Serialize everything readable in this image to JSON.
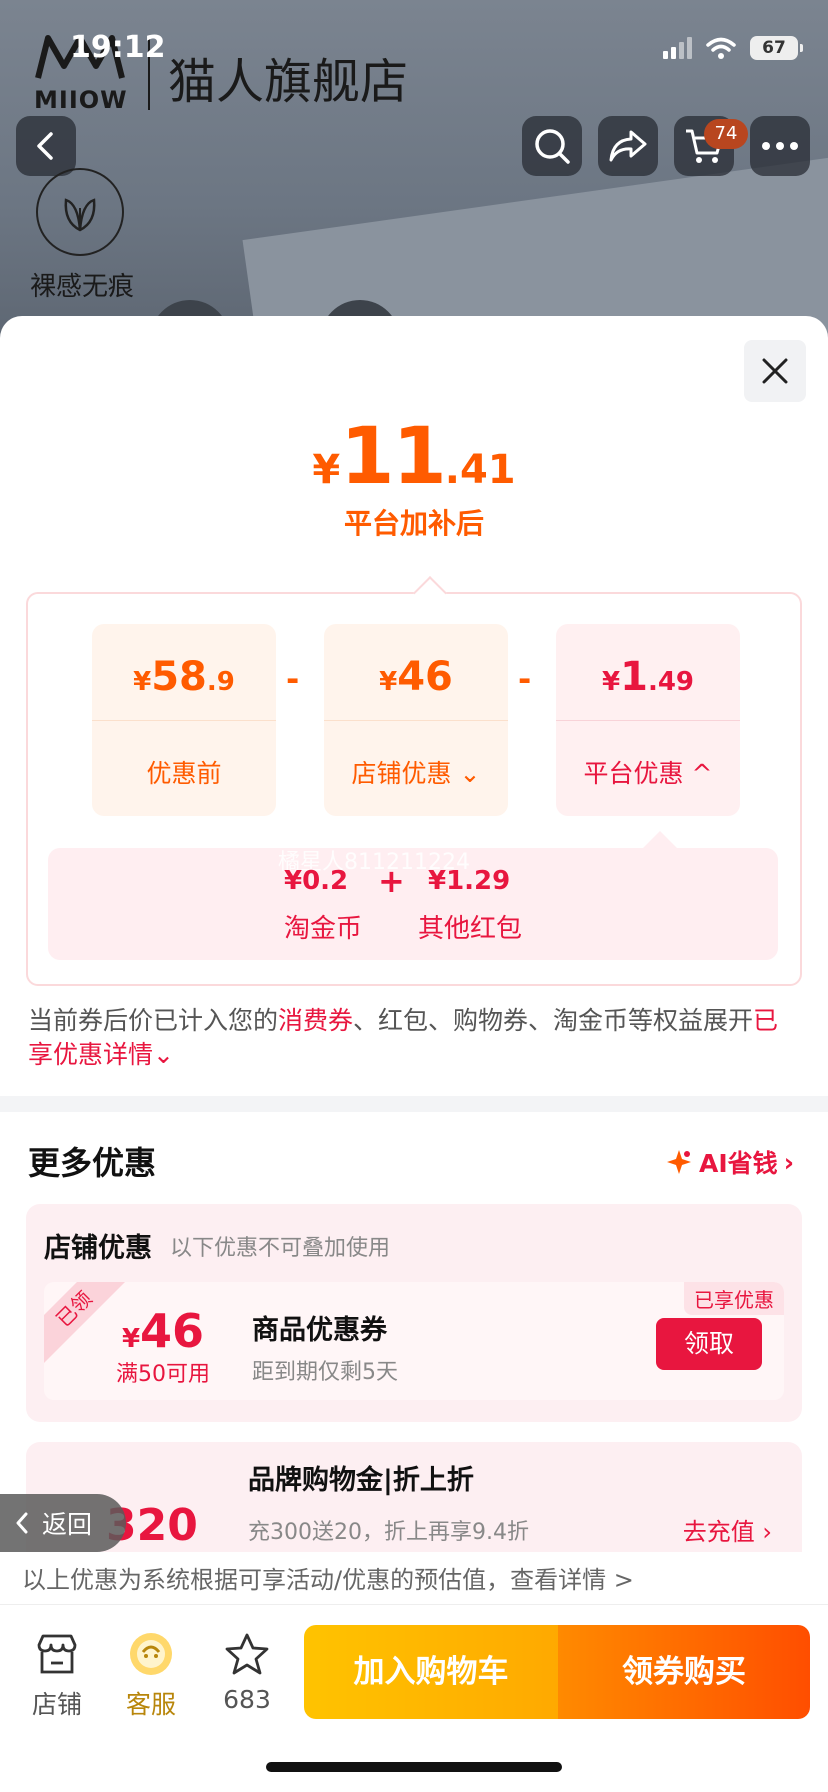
{
  "status_bar": {
    "time": "19:12",
    "battery": "67"
  },
  "header": {
    "logo_text": "MIIOW",
    "store_name": "猫人旗舰店",
    "cart_count": "74",
    "feature_label": "裸感无痕"
  },
  "price": {
    "currency": "¥",
    "integer": "11",
    "decimal": ".41",
    "subtitle": "平台加补后"
  },
  "calc": {
    "original": {
      "currency": "¥",
      "integer": "58",
      "decimal": ".9",
      "label": "优惠前"
    },
    "minus": "-",
    "store_discount": {
      "currency": "¥",
      "integer": "46",
      "decimal": "",
      "label": "店铺优惠",
      "chevron": "⌄"
    },
    "platform_discount": {
      "currency": "¥",
      "integer": "1",
      "decimal": ".49",
      "label": "平台优惠",
      "chevron": "^"
    },
    "watermark": "橘星人811211224",
    "breakdown": {
      "coin_value": "¥0.2",
      "coin_label": "淘金币",
      "plus": "+",
      "redpacket_value": "¥1.29",
      "redpacket_label": "其他红包"
    }
  },
  "note": {
    "part1": "当前券后价已计入您的",
    "highlight1": "消费券",
    "part2": "、红包、购物券、淘金币等权益展开",
    "highlight2": "已享优惠详情",
    "chevron": "⌄"
  },
  "more": {
    "title": "更多优惠",
    "ai_label": "AI省钱",
    "ai_chevron": "›"
  },
  "store_offers": {
    "title": "店铺优惠",
    "hint": "以下优惠不可叠加使用",
    "coupon": {
      "ribbon": "已领",
      "currency": "¥",
      "amount": "46",
      "condition": "满50可用",
      "name": "商品优惠券",
      "expiry": "距到期仅剩5天",
      "enjoyed": "已享优惠",
      "button": "领取"
    }
  },
  "brand_offer": {
    "title": "品牌购物金|折上折",
    "amount": "320",
    "desc": "充300送20，折上再享9.4折",
    "link": "去充值 ›"
  },
  "back_pill": {
    "label": "返回"
  },
  "footer_note": "以上优惠为系统根据可享活动/优惠的预估值，查看详情 >",
  "bottom_bar": {
    "store_label": "店铺",
    "service_label": "客服",
    "fav_count": "683",
    "add_cart": "加入购物车",
    "buy": "领券购买"
  },
  "colors": {
    "orange": "#ff5b00",
    "red": "#e8163f",
    "cart_yellow": "#ffb400"
  }
}
